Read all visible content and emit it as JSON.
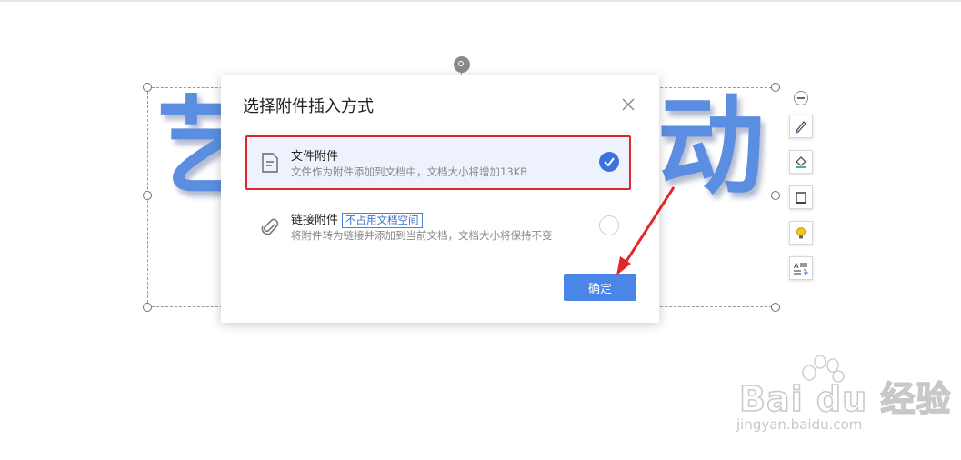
{
  "canvas": {
    "wordart_left": "艺",
    "wordart_right": "动画"
  },
  "side_toolbar": {
    "items": [
      "collapse-icon",
      "brush-icon",
      "fill-icon",
      "border-icon",
      "lightbulb-icon",
      "text-wrap-icon"
    ]
  },
  "dialog": {
    "title": "选择附件插入方式",
    "options": [
      {
        "title": "文件附件",
        "description": "文件作为附件添加到文档中，文档大小将增加13KB",
        "icon": "file-icon",
        "selected": true
      },
      {
        "title": "链接附件",
        "badge": "不占用文档空间",
        "description": "将附件转为链接并添加到当前文档，文档大小将保持不变",
        "icon": "paperclip-icon",
        "selected": false
      }
    ],
    "confirm_label": "确定"
  },
  "watermark": {
    "main": "Bai du 经验",
    "sub": "jingyan.baidu.com"
  },
  "colors": {
    "accent": "#4a86e8",
    "highlight": "#e02828",
    "wordart": "#5b8ee0"
  }
}
